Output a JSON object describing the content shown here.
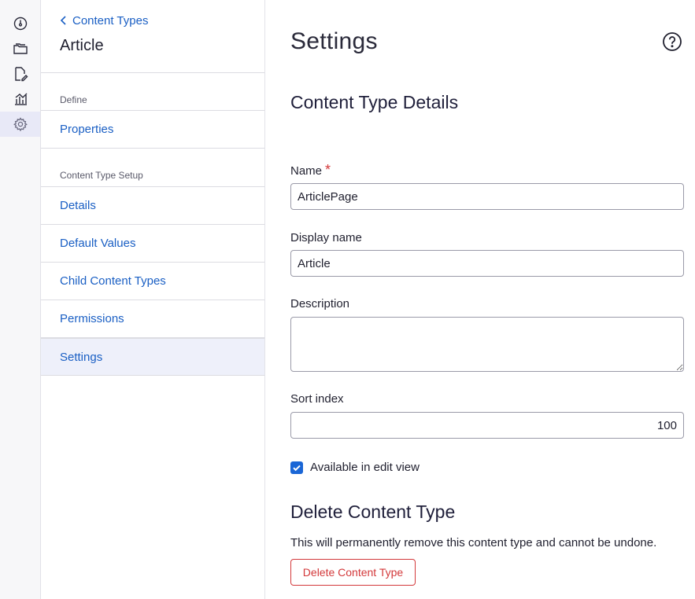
{
  "rail": {
    "items": [
      {
        "icon": "dashboard-icon"
      },
      {
        "icon": "folders-icon"
      },
      {
        "icon": "edit-document-icon"
      },
      {
        "icon": "analytics-icon"
      },
      {
        "icon": "settings-gear-icon",
        "active": true
      }
    ]
  },
  "subnav": {
    "back_label": "Content Types",
    "title": "Article",
    "groups": [
      {
        "label": "Define",
        "items": [
          "Properties"
        ]
      },
      {
        "label": "Content Type Setup",
        "items": [
          "Details",
          "Default Values",
          "Child Content Types",
          "Permissions",
          "Settings"
        ]
      }
    ],
    "active_item": "Settings"
  },
  "main": {
    "title": "Settings",
    "details_heading": "Content Type Details",
    "name_label": "Name",
    "name_required_mark": "*",
    "name_value": "ArticlePage",
    "display_name_label": "Display name",
    "display_name_value": "Article",
    "description_label": "Description",
    "description_value": "",
    "sort_index_label": "Sort index",
    "sort_index_value": "100",
    "available_label": "Available in edit view",
    "available_checked": true,
    "delete_heading": "Delete Content Type",
    "delete_warning": "This will permanently remove this content type and cannot be undone.",
    "delete_button": "Delete Content Type"
  },
  "colors": {
    "link": "#1a5fc4",
    "danger": "#d3383a",
    "checkbox": "#1a66d6",
    "active_bg": "#eef0fa"
  }
}
